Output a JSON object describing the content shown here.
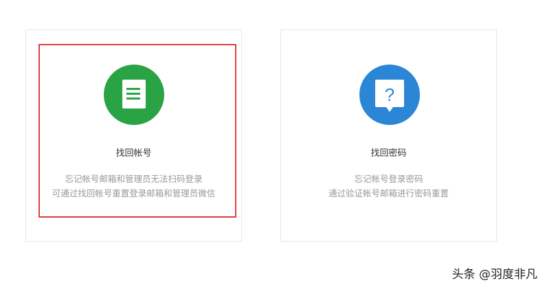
{
  "cards": [
    {
      "title": "找回帐号",
      "desc_line1": "忘记帐号邮箱和管理员无法扫码登录",
      "desc_line2": "可通过找回帐号重置登录邮箱和管理员微信",
      "icon": "document-icon",
      "color": "#2aa344",
      "selected": true
    },
    {
      "title": "找回密码",
      "desc_line1": "忘记帐号登录密码",
      "desc_line2": "通过验证帐号邮箱进行密码重置",
      "icon": "question-bubble-icon",
      "color": "#2b86d6",
      "selected": false
    }
  ],
  "watermark": "头条 @羽度非凡",
  "highlight_color": "#e03e3e"
}
